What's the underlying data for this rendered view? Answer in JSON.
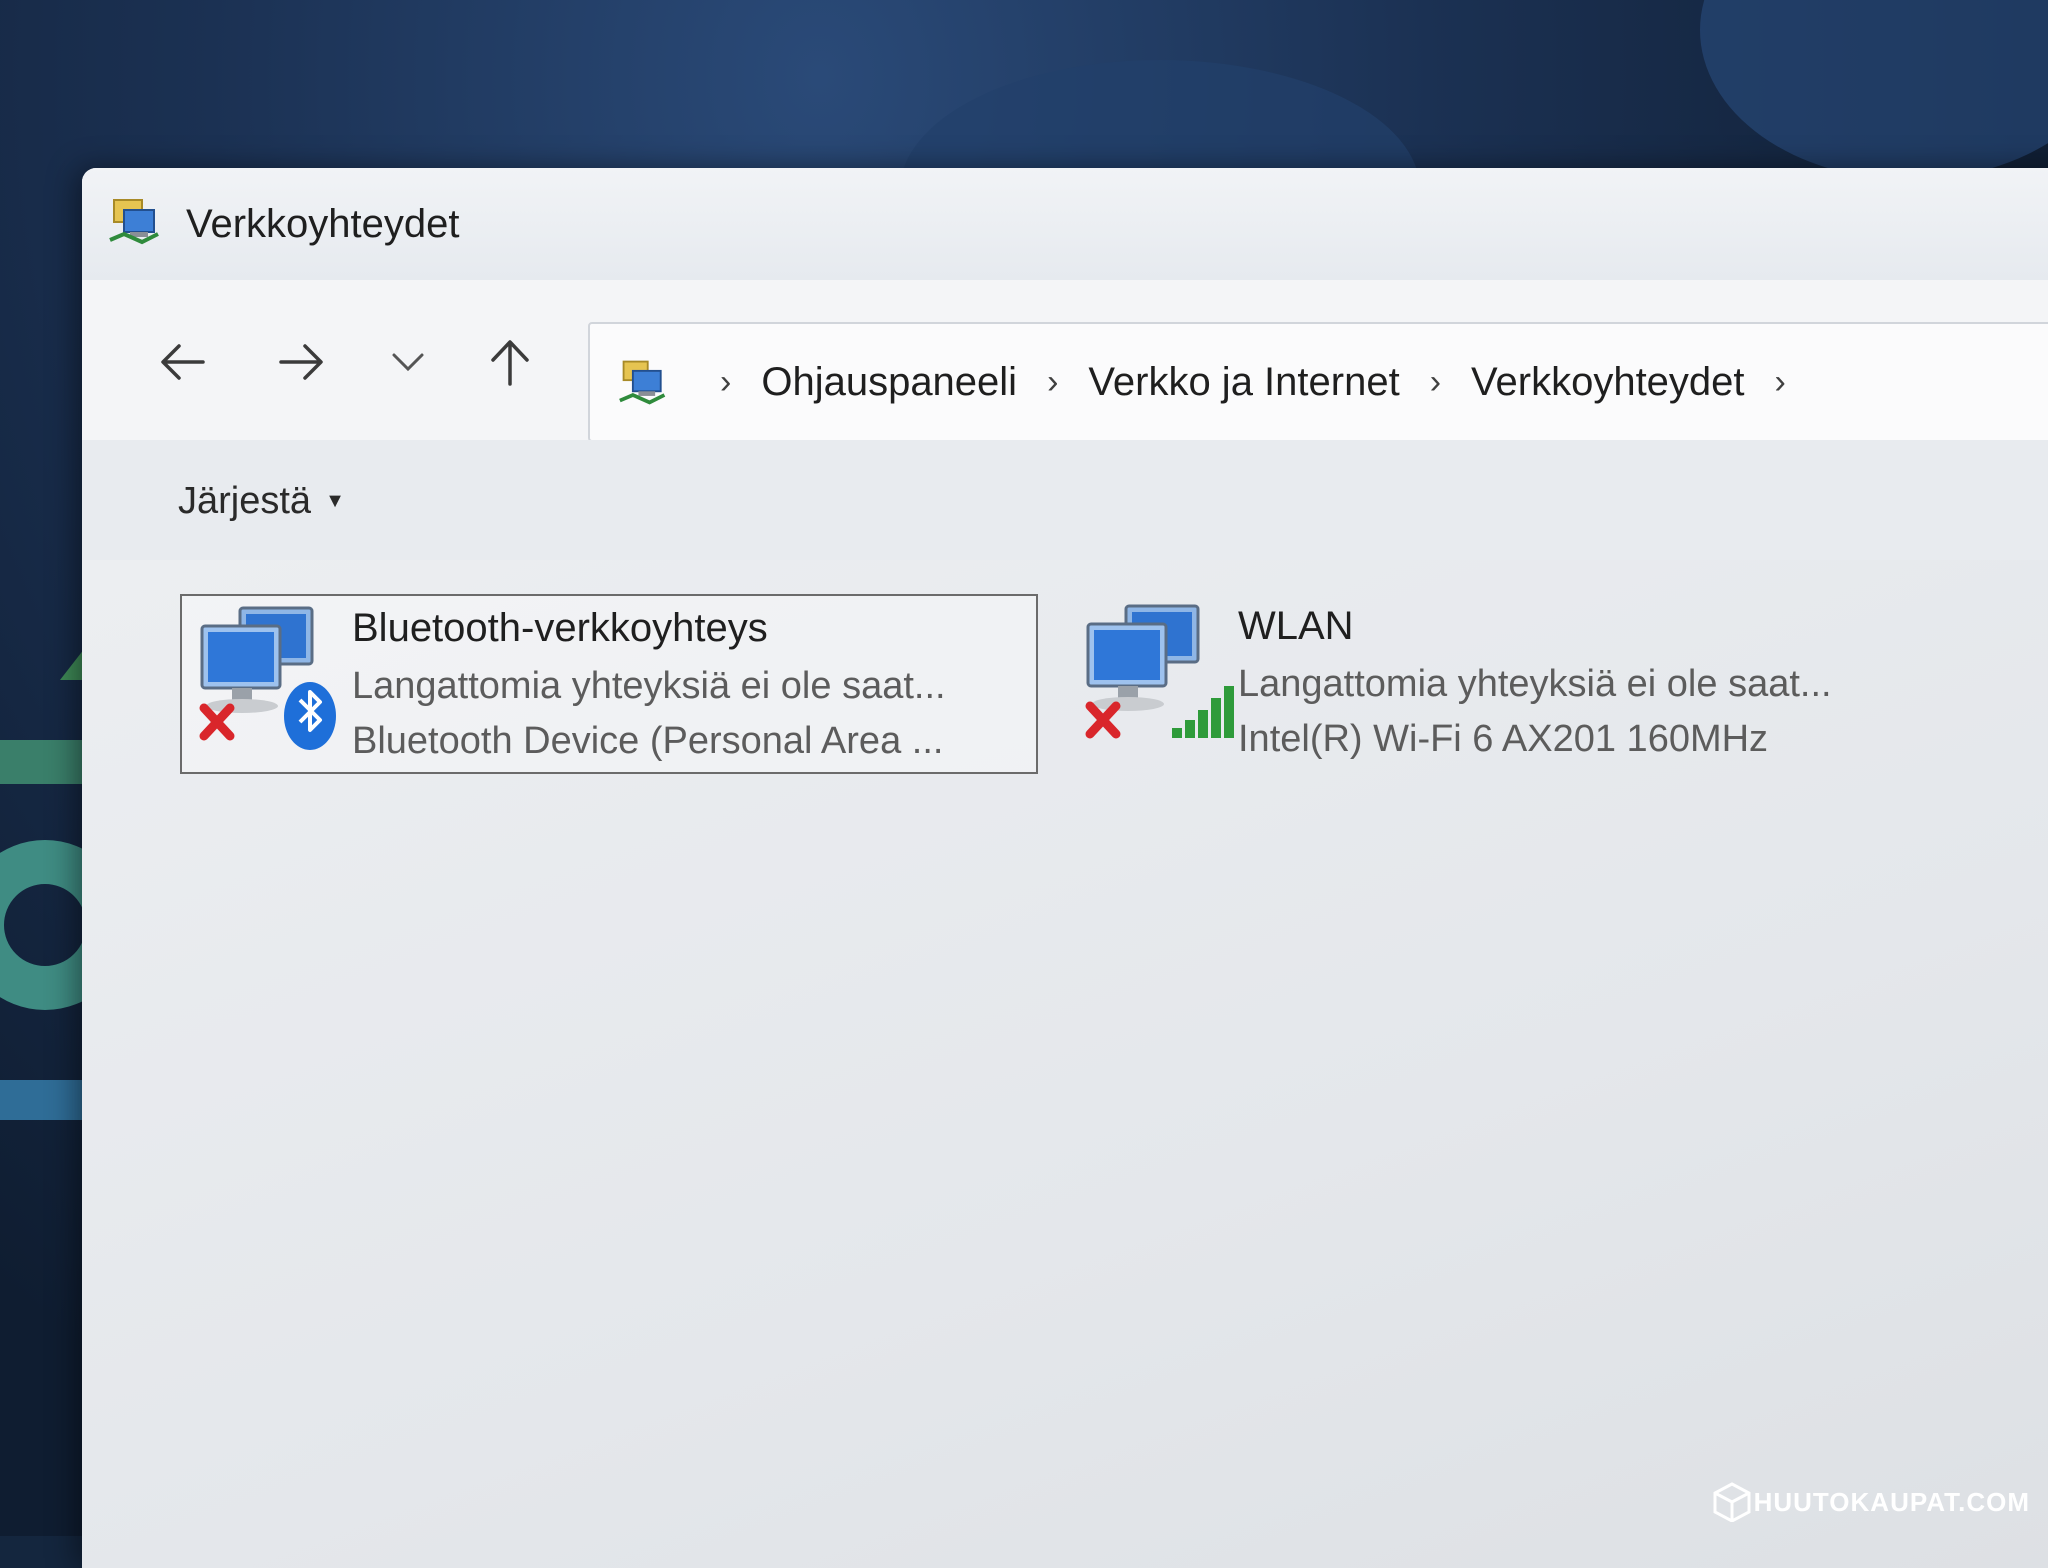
{
  "window": {
    "title": "Verkkoyhteydet"
  },
  "breadcrumb": [
    "Ohjauspaneeli",
    "Verkko ja Internet",
    "Verkkoyhteydet"
  ],
  "commandbar": {
    "organize_label": "Järjestä"
  },
  "connections": [
    {
      "name": "Bluetooth-verkkoyhteys",
      "status": "Langattomia yhteyksiä ei ole saat...",
      "device": "Bluetooth Device (Personal Area ...",
      "icon": "bluetooth-network-disconnected-icon",
      "selected": true
    },
    {
      "name": "WLAN",
      "status": "Langattomia yhteyksiä ei ole saat...",
      "device": "Intel(R) Wi-Fi 6 AX201 160MHz",
      "icon": "wifi-network-disconnected-icon",
      "selected": false
    }
  ],
  "watermark": "HUUTOKAUPAT.COM",
  "colors": {
    "error_red": "#d9262b",
    "bluetooth_blue": "#1e6fd9",
    "signal_green": "#2e9b3a"
  }
}
